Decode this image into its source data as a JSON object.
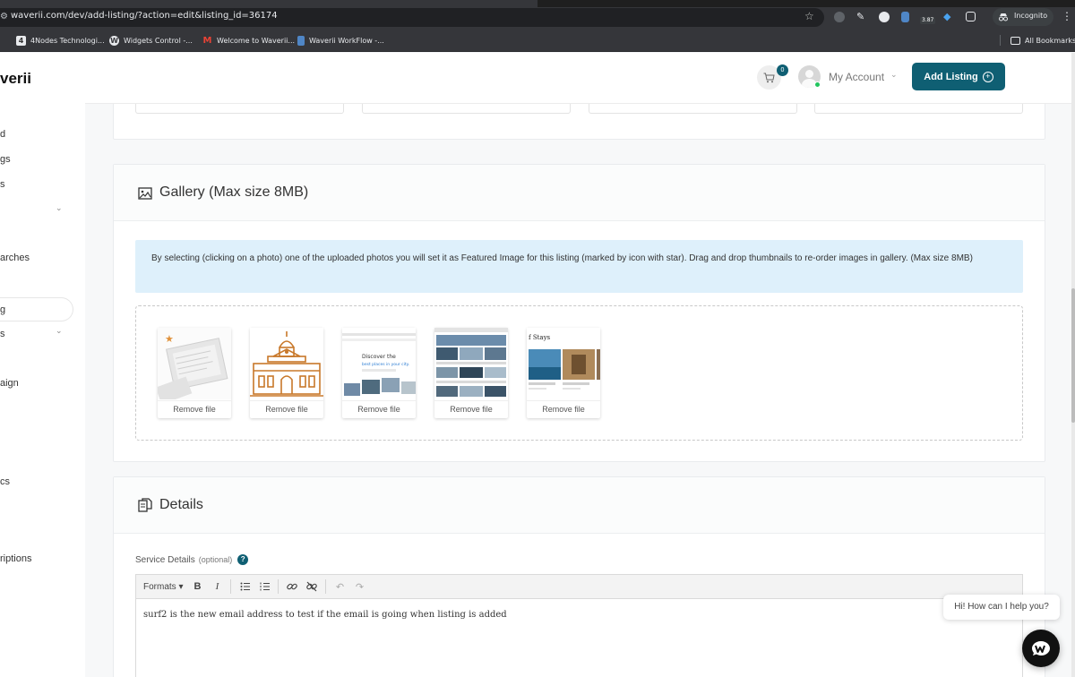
{
  "browser": {
    "url": "waverii.com/dev/add-listing/?action=edit&listing_id=36174",
    "extension_badge": "3.87",
    "incognito_label": "Incognito",
    "bookmarks": [
      {
        "label": "4Nodes Technologi...",
        "icon": "4nodes-icon"
      },
      {
        "label": "Widgets Control -...",
        "icon": "wordpress-icon"
      },
      {
        "label": "Welcome to Waverii...",
        "icon": "gmail-icon"
      },
      {
        "label": "Waverii WorkFlow -...",
        "icon": "doc-icon"
      }
    ],
    "all_bookmarks_label": "All Bookmarks"
  },
  "sidebar": {
    "logo": "verii",
    "items": [
      {
        "label": "d"
      },
      {
        "label": "gs"
      },
      {
        "label": "s"
      },
      {
        "label": "arches"
      },
      {
        "label": "g"
      },
      {
        "label": "s"
      },
      {
        "label": "aign"
      },
      {
        "label": "cs"
      },
      {
        "label": "riptions"
      }
    ]
  },
  "header": {
    "cart_count": "0",
    "account_label": "My Account",
    "add_listing_label": "Add Listing"
  },
  "gallery": {
    "title": "Gallery (Max size 8MB)",
    "info": "By selecting (clicking on a photo) one of the uploaded photos you will set it as Featured Image for this listing (marked by icon with star). Drag and drop thumbnails to re-order images in gallery. (Max size 8MB)",
    "remove_label": "Remove file",
    "thumb_texts": {
      "discover_line1": "Discover the",
      "discover_line2": "best places in your city.",
      "stays": "f Stays"
    }
  },
  "details": {
    "title": "Details",
    "field_label": "Service Details",
    "field_optional": "(optional)",
    "help": "?",
    "toolbar": {
      "formats": "Formats",
      "bold": "B",
      "italic": "I"
    },
    "content": "surf2 is the new email address to test if the email is going when listing is added"
  },
  "chat": {
    "greeting": "Hi! How can I help you?"
  },
  "colors": {
    "brand": "#0f5f73",
    "info_bg": "#def0fb",
    "star": "#e0913a",
    "online": "#22c55e"
  }
}
